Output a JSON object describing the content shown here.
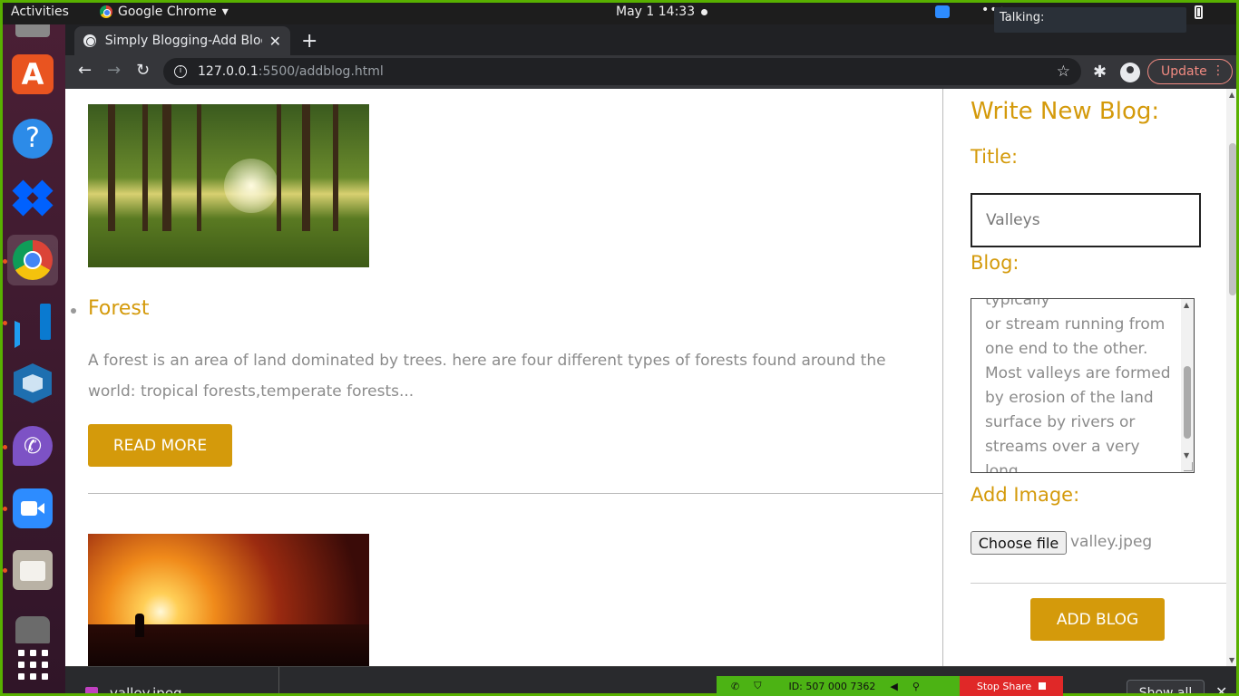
{
  "topbar": {
    "activities": "Activities",
    "app_name": "Google Chrome",
    "clock": "May 1  14:33",
    "talking": "Talking:"
  },
  "dock": {
    "items": [
      "software-center",
      "help",
      "dropbox",
      "chrome",
      "vscode",
      "virtualbox",
      "viber",
      "zoom",
      "files",
      "disk",
      "app-grid"
    ]
  },
  "browser": {
    "tab_title": "Simply Blogging-Add Blog",
    "url_host": "127.0.0.1",
    "url_path": ":5500/addblog.html",
    "update_label": "Update"
  },
  "page": {
    "posts": [
      {
        "title": "Forest",
        "excerpt": "A forest is an area of land dominated by trees. here are four different types of forests found around the world: tropical forests,temperate forests...",
        "button": "READ MORE"
      }
    ],
    "form": {
      "heading": "Write New Blog:",
      "title_label": "Title:",
      "title_value": "Valleys",
      "blog_label": "Blog:",
      "blog_value": "typically\nor stream running from\none end to the other.\nMost valleys are formed\nby erosion of the land\nsurface by rivers or\nstreams over a very long\nperiod of time.",
      "image_label": "Add Image:",
      "choose_file": "Choose file",
      "file_name": "valley.jpeg",
      "submit": "ADD BLOG"
    },
    "accent_color": "#d49a0b"
  },
  "download_shelf": {
    "file": "valley.jpeg",
    "show_all": "Show all"
  },
  "share_bar": {
    "meeting_id": "ID: 507 000 7362",
    "stop_share": "Stop Share"
  }
}
